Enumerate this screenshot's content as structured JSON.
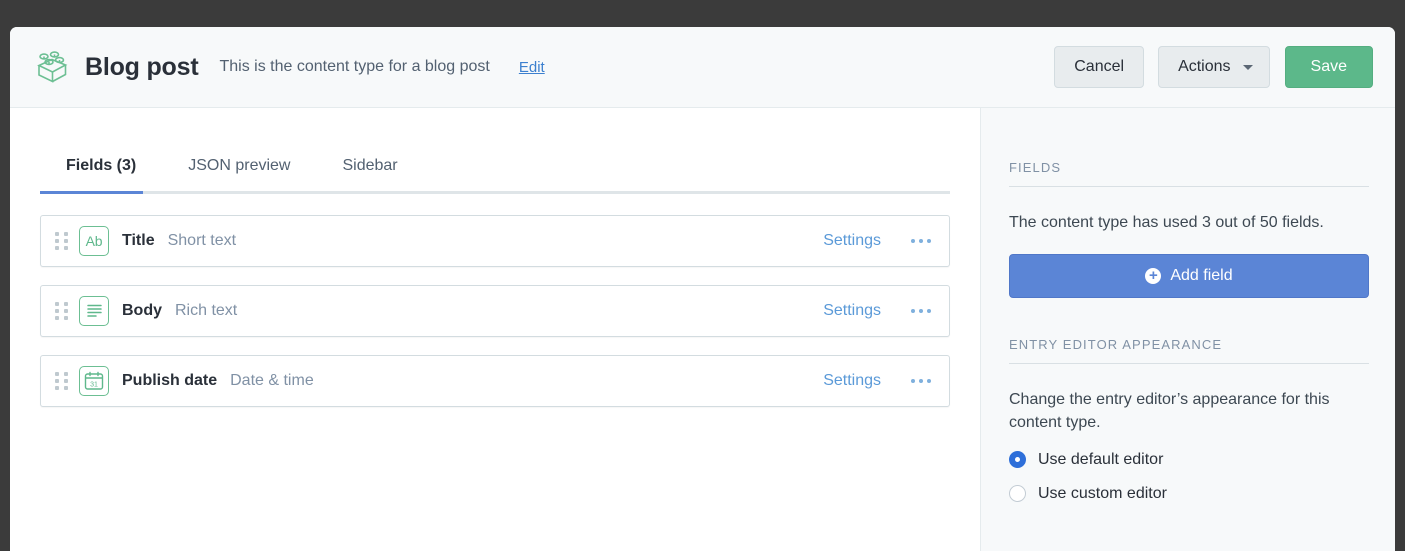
{
  "header": {
    "icon": "lego-brick-icon",
    "title": "Blog post",
    "description": "This is the content type for a blog post",
    "edit_label": "Edit",
    "cancel_label": "Cancel",
    "actions_label": "Actions",
    "save_label": "Save",
    "accent_green": "#5cb88a",
    "accent_blue": "#5b85d6"
  },
  "tabs": [
    {
      "label": "Fields (3)",
      "active": true
    },
    {
      "label": "JSON preview",
      "active": false
    },
    {
      "label": "Sidebar",
      "active": false
    }
  ],
  "fields": [
    {
      "name": "Title",
      "type": "Short text",
      "icon": "short-text-icon",
      "icon_glyph": "Ab",
      "settings_label": "Settings",
      "more_label": "..."
    },
    {
      "name": "Body",
      "type": "Rich text",
      "icon": "rich-text-icon",
      "icon_glyph": "",
      "settings_label": "Settings",
      "more_label": "..."
    },
    {
      "name": "Publish date",
      "type": "Date & time",
      "icon": "calendar-icon",
      "icon_glyph": "31",
      "settings_label": "Settings",
      "more_label": "..."
    }
  ],
  "sidebar": {
    "fields_heading": "FIELDS",
    "fields_usage": "The content type has used 3 out of 50 fields.",
    "add_field_label": "Add field",
    "add_field_icon": "plus-circle-icon",
    "appearance_heading": "ENTRY EDITOR APPEARANCE",
    "appearance_text": "Change the entry editor’s appearance for this content type.",
    "radios": [
      {
        "label": "Use default editor",
        "checked": true
      },
      {
        "label": "Use custom editor",
        "checked": false
      }
    ]
  }
}
